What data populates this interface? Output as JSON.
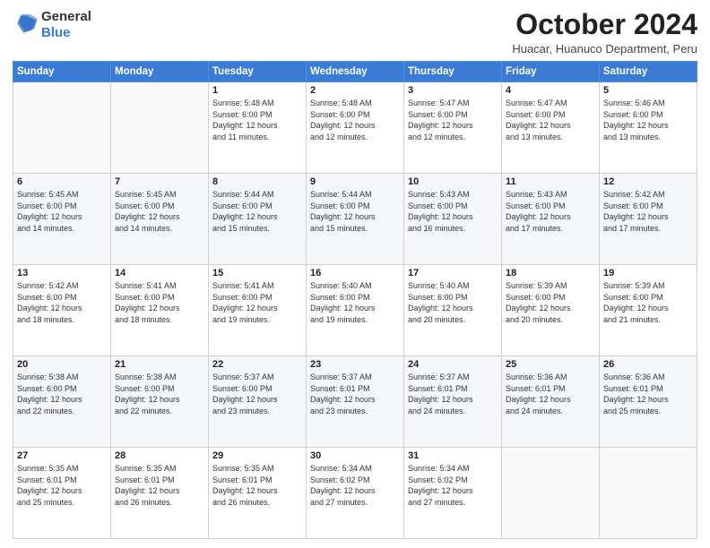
{
  "header": {
    "logo_line1": "General",
    "logo_line2": "Blue",
    "title": "October 2024",
    "subtitle": "Huacar, Huanuco Department, Peru"
  },
  "weekdays": [
    "Sunday",
    "Monday",
    "Tuesday",
    "Wednesday",
    "Thursday",
    "Friday",
    "Saturday"
  ],
  "weeks": [
    [
      {
        "day": "",
        "details": ""
      },
      {
        "day": "",
        "details": ""
      },
      {
        "day": "1",
        "details": "Sunrise: 5:48 AM\nSunset: 6:00 PM\nDaylight: 12 hours\nand 11 minutes."
      },
      {
        "day": "2",
        "details": "Sunrise: 5:48 AM\nSunset: 6:00 PM\nDaylight: 12 hours\nand 12 minutes."
      },
      {
        "day": "3",
        "details": "Sunrise: 5:47 AM\nSunset: 6:00 PM\nDaylight: 12 hours\nand 12 minutes."
      },
      {
        "day": "4",
        "details": "Sunrise: 5:47 AM\nSunset: 6:00 PM\nDaylight: 12 hours\nand 13 minutes."
      },
      {
        "day": "5",
        "details": "Sunrise: 5:46 AM\nSunset: 6:00 PM\nDaylight: 12 hours\nand 13 minutes."
      }
    ],
    [
      {
        "day": "6",
        "details": "Sunrise: 5:45 AM\nSunset: 6:00 PM\nDaylight: 12 hours\nand 14 minutes."
      },
      {
        "day": "7",
        "details": "Sunrise: 5:45 AM\nSunset: 6:00 PM\nDaylight: 12 hours\nand 14 minutes."
      },
      {
        "day": "8",
        "details": "Sunrise: 5:44 AM\nSunset: 6:00 PM\nDaylight: 12 hours\nand 15 minutes."
      },
      {
        "day": "9",
        "details": "Sunrise: 5:44 AM\nSunset: 6:00 PM\nDaylight: 12 hours\nand 15 minutes."
      },
      {
        "day": "10",
        "details": "Sunrise: 5:43 AM\nSunset: 6:00 PM\nDaylight: 12 hours\nand 16 minutes."
      },
      {
        "day": "11",
        "details": "Sunrise: 5:43 AM\nSunset: 6:00 PM\nDaylight: 12 hours\nand 17 minutes."
      },
      {
        "day": "12",
        "details": "Sunrise: 5:42 AM\nSunset: 6:00 PM\nDaylight: 12 hours\nand 17 minutes."
      }
    ],
    [
      {
        "day": "13",
        "details": "Sunrise: 5:42 AM\nSunset: 6:00 PM\nDaylight: 12 hours\nand 18 minutes."
      },
      {
        "day": "14",
        "details": "Sunrise: 5:41 AM\nSunset: 6:00 PM\nDaylight: 12 hours\nand 18 minutes."
      },
      {
        "day": "15",
        "details": "Sunrise: 5:41 AM\nSunset: 6:00 PM\nDaylight: 12 hours\nand 19 minutes."
      },
      {
        "day": "16",
        "details": "Sunrise: 5:40 AM\nSunset: 6:00 PM\nDaylight: 12 hours\nand 19 minutes."
      },
      {
        "day": "17",
        "details": "Sunrise: 5:40 AM\nSunset: 6:00 PM\nDaylight: 12 hours\nand 20 minutes."
      },
      {
        "day": "18",
        "details": "Sunrise: 5:39 AM\nSunset: 6:00 PM\nDaylight: 12 hours\nand 20 minutes."
      },
      {
        "day": "19",
        "details": "Sunrise: 5:39 AM\nSunset: 6:00 PM\nDaylight: 12 hours\nand 21 minutes."
      }
    ],
    [
      {
        "day": "20",
        "details": "Sunrise: 5:38 AM\nSunset: 6:00 PM\nDaylight: 12 hours\nand 22 minutes."
      },
      {
        "day": "21",
        "details": "Sunrise: 5:38 AM\nSunset: 6:00 PM\nDaylight: 12 hours\nand 22 minutes."
      },
      {
        "day": "22",
        "details": "Sunrise: 5:37 AM\nSunset: 6:00 PM\nDaylight: 12 hours\nand 23 minutes."
      },
      {
        "day": "23",
        "details": "Sunrise: 5:37 AM\nSunset: 6:01 PM\nDaylight: 12 hours\nand 23 minutes."
      },
      {
        "day": "24",
        "details": "Sunrise: 5:37 AM\nSunset: 6:01 PM\nDaylight: 12 hours\nand 24 minutes."
      },
      {
        "day": "25",
        "details": "Sunrise: 5:36 AM\nSunset: 6:01 PM\nDaylight: 12 hours\nand 24 minutes."
      },
      {
        "day": "26",
        "details": "Sunrise: 5:36 AM\nSunset: 6:01 PM\nDaylight: 12 hours\nand 25 minutes."
      }
    ],
    [
      {
        "day": "27",
        "details": "Sunrise: 5:35 AM\nSunset: 6:01 PM\nDaylight: 12 hours\nand 25 minutes."
      },
      {
        "day": "28",
        "details": "Sunrise: 5:35 AM\nSunset: 6:01 PM\nDaylight: 12 hours\nand 26 minutes."
      },
      {
        "day": "29",
        "details": "Sunrise: 5:35 AM\nSunset: 6:01 PM\nDaylight: 12 hours\nand 26 minutes."
      },
      {
        "day": "30",
        "details": "Sunrise: 5:34 AM\nSunset: 6:02 PM\nDaylight: 12 hours\nand 27 minutes."
      },
      {
        "day": "31",
        "details": "Sunrise: 5:34 AM\nSunset: 6:02 PM\nDaylight: 12 hours\nand 27 minutes."
      },
      {
        "day": "",
        "details": ""
      },
      {
        "day": "",
        "details": ""
      }
    ]
  ]
}
